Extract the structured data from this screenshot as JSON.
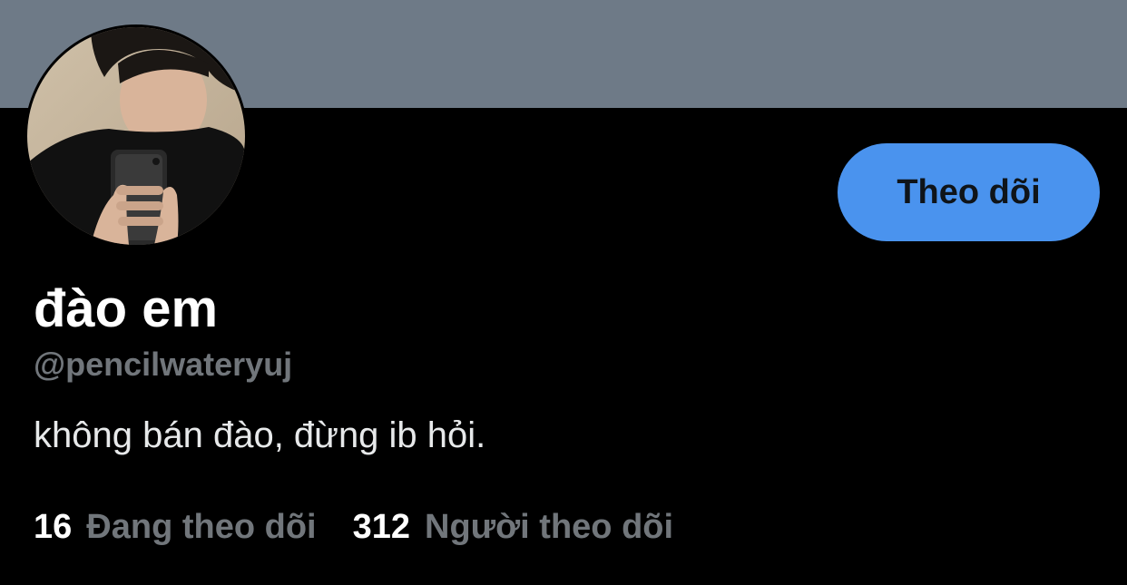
{
  "profile": {
    "display_name": "đào em",
    "handle": "@pencilwateryuj",
    "bio": "không bán đào, đừng ib hỏi.",
    "follow_button_label": "Theo dõi",
    "avatar_icon": "avatar-photo"
  },
  "stats": {
    "following_count": "16",
    "following_label": "Đang theo dõi",
    "followers_count": "312",
    "followers_label": "Người theo dõi"
  },
  "colors": {
    "banner": "#6e7a87",
    "background": "#000000",
    "accent_button": "#4a93ee",
    "secondary_text": "#71767b"
  }
}
